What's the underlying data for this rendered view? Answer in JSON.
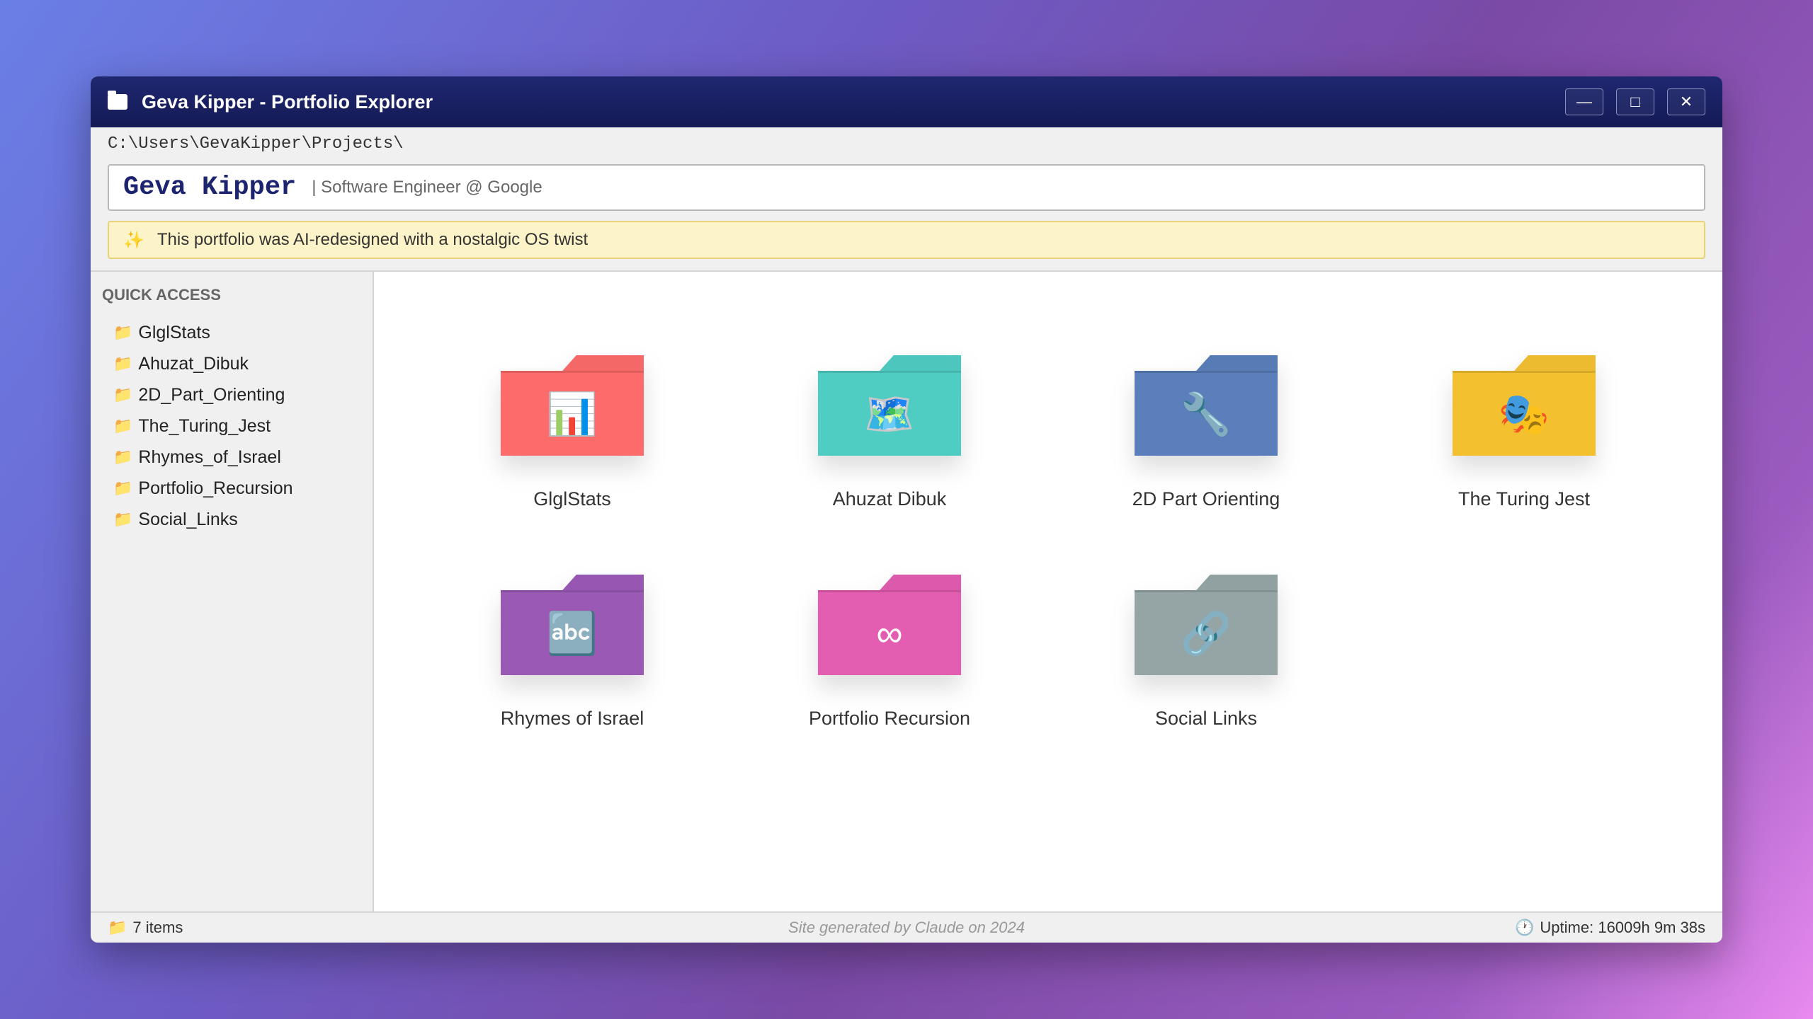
{
  "window": {
    "title": "Geva Kipper - Portfolio Explorer",
    "minimize": "—",
    "maximize": "□",
    "close": "✕"
  },
  "path": "C:\\Users\\GevaKipper\\Projects\\",
  "header": {
    "name": "Geva Kipper",
    "subtitle": "| Software Engineer @ Google"
  },
  "banner": {
    "icon": "✨",
    "text": "This portfolio was AI-redesigned with a nostalgic OS twist"
  },
  "sidebar": {
    "heading": "QUICK ACCESS",
    "folder_icon": "📁",
    "items": [
      "GlglStats",
      "Ahuzat_Dibuk",
      "2D_Part_Orienting",
      "The_Turing_Jest",
      "Rhymes_of_Israel",
      "Portfolio_Recursion",
      "Social_Links"
    ]
  },
  "folders": [
    {
      "label": "GlglStats",
      "emoji": "📊",
      "color": "#fd6b6b"
    },
    {
      "label": "Ahuzat Dibuk",
      "emoji": "🗺️",
      "color": "#4fcdc3"
    },
    {
      "label": "2D Part Orienting",
      "emoji": "🔧",
      "color": "#5a7fba"
    },
    {
      "label": "The Turing Jest",
      "emoji": "🎭",
      "color": "#f3c130"
    },
    {
      "label": "Rhymes of Israel",
      "emoji": "🔤",
      "color": "#9b59b6"
    },
    {
      "label": "Portfolio Recursion",
      "emoji": "∞",
      "color": "#e35db0"
    },
    {
      "label": "Social Links",
      "emoji": "🔗",
      "color": "#95a5a6"
    }
  ],
  "status": {
    "icon": "📁",
    "items": "7 items",
    "generated": "Site generated by Claude on 2024",
    "clock_icon": "🕐",
    "uptime": "Uptime: 16009h 9m 38s"
  }
}
